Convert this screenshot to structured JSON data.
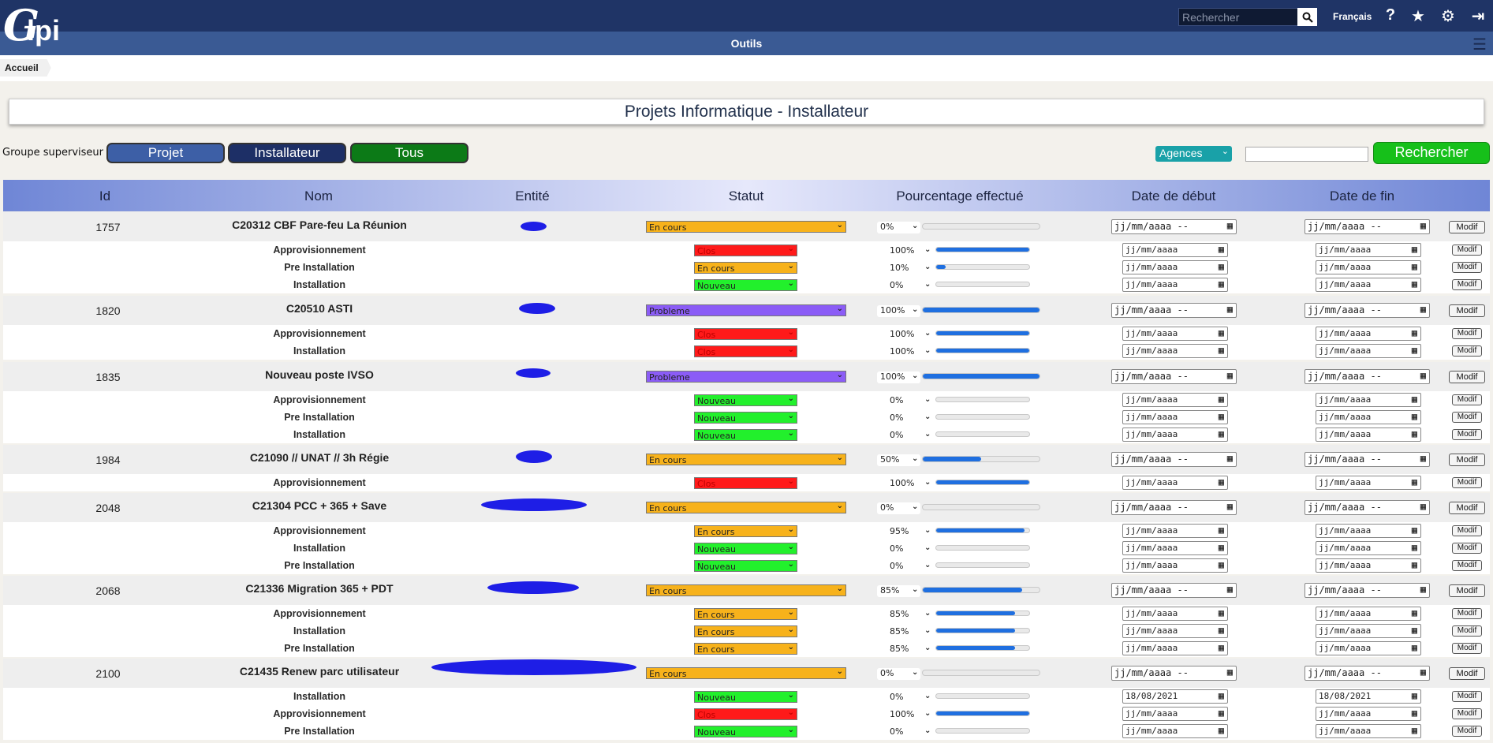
{
  "app": {
    "logo": "Glpi",
    "search_placeholder": "Rechercher",
    "language": "Français",
    "section_title": "Outils",
    "breadcrumb": "Accueil"
  },
  "page": {
    "title": "Projets Informatique - Installateur"
  },
  "filters": {
    "group_label": "Groupe superviseur :",
    "groups": [
      "Projet",
      "Installateur",
      "Tous"
    ],
    "agence_label": "Agences",
    "search_button": "Rechercher"
  },
  "table": {
    "columns": [
      "Id",
      "Nom",
      "Entité",
      "Statut",
      "Pourcentage effectué",
      "Date de début",
      "Date de fin"
    ],
    "modif_label": "Modif",
    "date_placeholder_main": "jj/mm/aaaa --",
    "date_placeholder_sub": "jj/mm/aaaa",
    "projects": [
      {
        "id": "1757",
        "name": "C20312 CBF Pare-feu La Réunion",
        "status": "En cours",
        "percent": "0%",
        "progress": 0,
        "tasks": [
          {
            "name": "Approvisionnement",
            "status": "Clos",
            "percent": "100%",
            "progress": 100
          },
          {
            "name": "Pre Installation",
            "status": "En cours",
            "percent": "10%",
            "progress": 10
          },
          {
            "name": "Installation",
            "status": "Nouveau",
            "percent": "0%",
            "progress": 0
          }
        ]
      },
      {
        "id": "1820",
        "name": "C20510 ASTI",
        "status": "Probleme",
        "percent": "100%",
        "progress": 100,
        "tasks": [
          {
            "name": "Approvisionnement",
            "status": "Clos",
            "percent": "100%",
            "progress": 100
          },
          {
            "name": "Installation",
            "status": "Clos",
            "percent": "100%",
            "progress": 100
          }
        ]
      },
      {
        "id": "1835",
        "name": "Nouveau poste IVSO",
        "status": "Probleme",
        "percent": "100%",
        "progress": 100,
        "tasks": [
          {
            "name": "Approvisionnement",
            "status": "Nouveau",
            "percent": "0%",
            "progress": 0
          },
          {
            "name": "Pre Installation",
            "status": "Nouveau",
            "percent": "0%",
            "progress": 0
          },
          {
            "name": "Installation",
            "status": "Nouveau",
            "percent": "0%",
            "progress": 0
          }
        ]
      },
      {
        "id": "1984",
        "name": "C21090 // UNAT // 3h Régie",
        "status": "En cours",
        "percent": "50%",
        "progress": 50,
        "tasks": [
          {
            "name": "Approvisionnement",
            "status": "Clos",
            "percent": "100%",
            "progress": 100
          }
        ]
      },
      {
        "id": "2048",
        "name": "C21304 PCC + 365 + Save",
        "status": "En cours",
        "percent": "0%",
        "progress": 0,
        "tasks": [
          {
            "name": "Approvisionnement",
            "status": "En cours",
            "percent": "95%",
            "progress": 95
          },
          {
            "name": "Installation",
            "status": "Nouveau",
            "percent": "0%",
            "progress": 0
          },
          {
            "name": "Pre Installation",
            "status": "Nouveau",
            "percent": "0%",
            "progress": 0
          }
        ]
      },
      {
        "id": "2068",
        "name": "C21336 Migration 365 + PDT",
        "status": "En cours",
        "percent": "85%",
        "progress": 85,
        "tasks": [
          {
            "name": "Approvisionnement",
            "status": "En cours",
            "percent": "85%",
            "progress": 85
          },
          {
            "name": "Installation",
            "status": "En cours",
            "percent": "85%",
            "progress": 85
          },
          {
            "name": "Pre Installation",
            "status": "En cours",
            "percent": "85%",
            "progress": 85
          }
        ]
      },
      {
        "id": "2100",
        "name": "C21435 Renew parc utilisateur",
        "status": "En cours",
        "percent": "0%",
        "progress": 0,
        "tasks": [
          {
            "name": "Installation",
            "status": "Nouveau",
            "percent": "0%",
            "progress": 0,
            "start": "18/08/2021",
            "end": "18/08/2021"
          },
          {
            "name": "Approvisionnement",
            "status": "Clos",
            "percent": "100%",
            "progress": 100
          },
          {
            "name": "Pre Installation",
            "status": "Nouveau",
            "percent": "0%",
            "progress": 0
          }
        ]
      }
    ]
  },
  "colors": {
    "header": "#1f3466",
    "subheader": "#3a5a94",
    "btn_projet": "#3d5fa6",
    "btn_installateur": "#1d2f66",
    "btn_tous": "#0c7a17",
    "btn_rechercher": "#16c01a",
    "status_en_cours": "#f7b21b",
    "status_clos": "#ff1a1a",
    "status_nouveau": "#22f02c",
    "status_probleme": "#8b5cf6",
    "progress": "#1f6fe0"
  },
  "icons": [
    "search-icon",
    "help-icon",
    "star-icon",
    "gear-icon",
    "logout-icon",
    "hamburger-icon",
    "calendar-icon",
    "chevron-down-icon"
  ]
}
